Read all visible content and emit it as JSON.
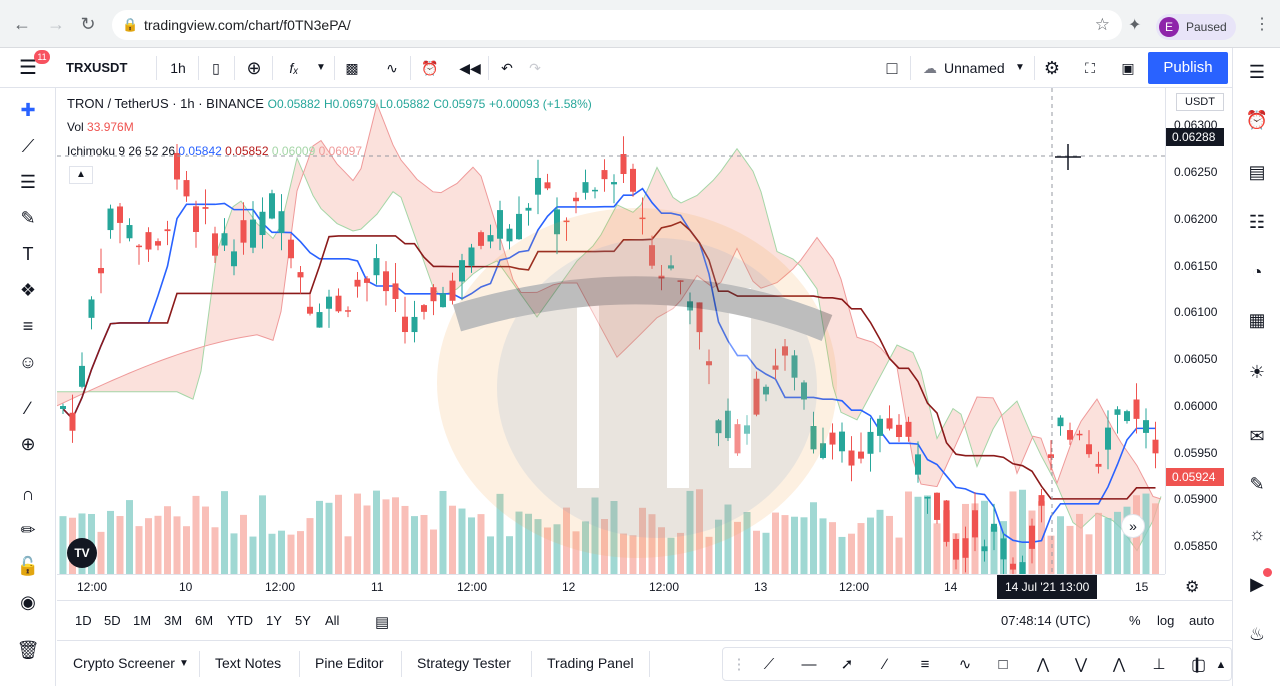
{
  "browser": {
    "url": "tradingview.com/chart/f0TN3ePA/",
    "profile_initial": "E",
    "profile_status": "Paused"
  },
  "toolbar": {
    "symbol": "TRXUSDT",
    "interval": "1h",
    "layout_name": "Unnamed",
    "publish_label": "Publish",
    "notification_count": "11"
  },
  "legend": {
    "title": "TRON / TetherUS · 1h · BINANCE",
    "open": "O0.05882",
    "high": "H0.06979",
    "low": "L0.05882",
    "close": "C0.05975",
    "change": "+0.00093 (+1.58%)",
    "vol_label": "Vol",
    "vol_value": "33.976M",
    "ichimoku_label": "Ichimoku 9 26 52 26",
    "ich_v1": "0.05842",
    "ich_v2": "0.05852",
    "ich_v3": "0.06009",
    "ich_v4": "0.06097"
  },
  "chart_data": {
    "type": "candlestick",
    "y_ticks": [
      "0.06300",
      "0.06250",
      "0.06200",
      "0.06150",
      "0.06100",
      "0.06050",
      "0.06000",
      "0.05950",
      "0.05900",
      "0.05850"
    ],
    "x_ticks": [
      "12:00",
      "10",
      "12:00",
      "11",
      "12:00",
      "12",
      "12:00",
      "13",
      "12:00",
      "14",
      "15"
    ],
    "crosshair_price": "0.06288",
    "last_price": "0.05924",
    "crosshair_time": "14 Jul '21   13:00",
    "currency": "USDT",
    "ylim": [
      0.0582,
      0.0634
    ]
  },
  "range": {
    "buttons": [
      "1D",
      "5D",
      "1M",
      "3M",
      "6M",
      "YTD",
      "1Y",
      "5Y",
      "All"
    ],
    "clock": "07:48:14 (UTC)",
    "pct": "%",
    "log": "log",
    "auto": "auto"
  },
  "bottom_tabs": [
    "Crypto Screener",
    "Text Notes",
    "Pine Editor",
    "Strategy Tester",
    "Trading Panel"
  ],
  "colors": {
    "up": "#26a69a",
    "down": "#ef5350",
    "accent": "#2962ff",
    "tenkan": "#2962ff",
    "kijun": "#b71c1c"
  }
}
